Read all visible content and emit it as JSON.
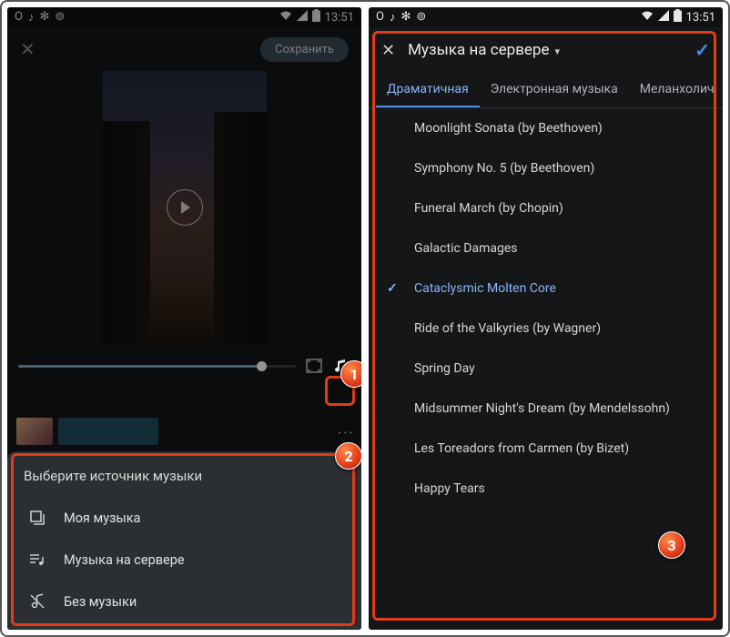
{
  "statusbar": {
    "time": "13:51",
    "icons": [
      "opera",
      "tiktok",
      "fan",
      "shazam"
    ]
  },
  "left": {
    "close": "✕",
    "save_label": "Сохранить",
    "aspect_icon": "aspect-ratio-icon",
    "music_icon": "music-note-icon",
    "kebab": "⋮",
    "sheet_title": "Выберите источник музыки",
    "sheet_items": [
      {
        "icon": "library",
        "label": "Моя музыка"
      },
      {
        "icon": "server",
        "label": "Музыка на сервере"
      },
      {
        "icon": "none",
        "label": "Без музыки"
      }
    ]
  },
  "right": {
    "close": "✕",
    "header_title": "Музыка на сервере",
    "header_chevron": "▾",
    "header_check": "✓",
    "tabs": [
      "Драматичная",
      "Электронная музыка",
      "Меланхолич"
    ],
    "active_tab": 0,
    "songs": [
      "Moonlight Sonata (by Beethoven)",
      "Symphony No. 5 (by Beethoven)",
      "Funeral March (by Chopin)",
      "Galactic Damages",
      "Cataclysmic Molten Core",
      "Ride of the Valkyries (by Wagner)",
      "Spring Day",
      "Midsummer Night's Dream (by Mendelssohn)",
      "Les Toreadors from Carmen (by Bizet)",
      "Happy Tears"
    ],
    "selected_index": 4
  },
  "badges": [
    "1",
    "2",
    "3"
  ]
}
